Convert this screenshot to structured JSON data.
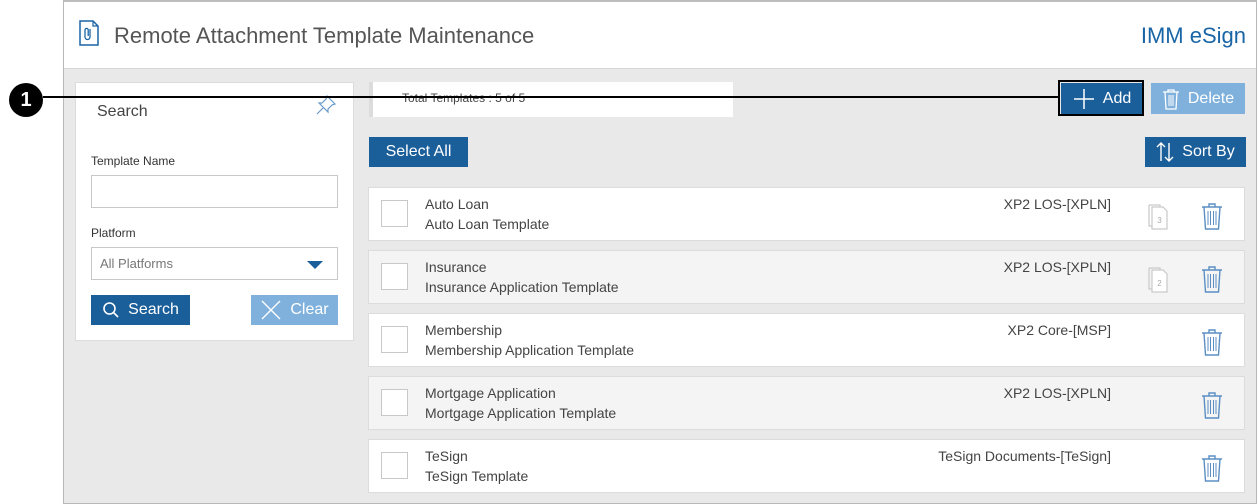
{
  "header": {
    "title": "Remote Attachment Template Maintenance",
    "brand": "IMM eSign"
  },
  "search": {
    "panel_title": "Search",
    "template_name_label": "Template Name",
    "template_name_value": "",
    "platform_label": "Platform",
    "platform_value": "All Platforms",
    "search_button": "Search",
    "clear_button": "Clear"
  },
  "toolbar": {
    "total_text": "Total Templates : 5 of 5",
    "add_button": "Add",
    "delete_button": "Delete",
    "select_all_button": "Select All",
    "sort_button": "Sort By"
  },
  "templates": [
    {
      "name": "Auto Loan",
      "description": "Auto Loan Template",
      "platform": "XP2 LOS-[XPLN]",
      "doc_count": "3"
    },
    {
      "name": "Insurance",
      "description": "Insurance Application Template",
      "platform": "XP2 LOS-[XPLN]",
      "doc_count": "2"
    },
    {
      "name": "Membership",
      "description": "Membership Application Template",
      "platform": "XP2 Core-[MSP]",
      "doc_count": ""
    },
    {
      "name": "Mortgage Application",
      "description": "Mortgage Application Template",
      "platform": "XP2 LOS-[XPLN]",
      "doc_count": ""
    },
    {
      "name": "TeSign",
      "description": "TeSign Template",
      "platform": "TeSign Documents-[TeSign]",
      "doc_count": ""
    }
  ],
  "callout": {
    "number": "1"
  },
  "colors": {
    "primary": "#1a5e9a",
    "primary_light": "#7fb1dc",
    "brand": "#1a65a6"
  }
}
